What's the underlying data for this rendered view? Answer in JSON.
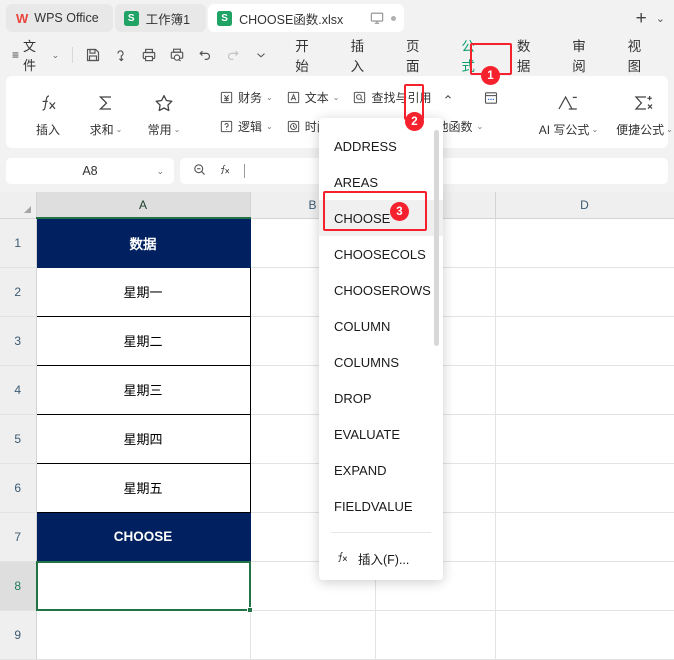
{
  "titlebar": {
    "app_label": "WPS Office",
    "app_mark": "W",
    "tabs": [
      {
        "icon": "spreadsheet-icon",
        "icon_letter": "S",
        "label": "工作簿1",
        "active": false
      },
      {
        "icon": "spreadsheet-icon",
        "icon_letter": "S",
        "label": "CHOOSE函数.xlsx",
        "active": true
      }
    ],
    "monitor_icon": "monitor-icon",
    "unsaved_dot": "unsaved-dot",
    "new_tab_label": "+",
    "tab_menu_caret": "⌄"
  },
  "menubar": {
    "hamburger": "≡",
    "file_label": "文件",
    "file_caret": "⌄",
    "quick_access": [
      {
        "name": "save-icon",
        "disabled": false
      },
      {
        "name": "cloud-save-icon",
        "disabled": false
      },
      {
        "name": "print-icon",
        "disabled": false
      },
      {
        "name": "print-preview-icon",
        "disabled": false
      },
      {
        "name": "undo-icon",
        "disabled": false
      },
      {
        "name": "redo-icon",
        "disabled": true
      },
      {
        "name": "qat-more-icon",
        "disabled": false
      }
    ],
    "tabs": [
      {
        "label": "开始",
        "active": false
      },
      {
        "label": "插入",
        "active": false
      },
      {
        "label": "页面",
        "active": false
      },
      {
        "label": "公式",
        "active": true
      },
      {
        "label": "数据",
        "active": false
      },
      {
        "label": "审阅",
        "active": false
      },
      {
        "label": "视图",
        "active": false
      }
    ]
  },
  "ribbon": {
    "big_buttons": [
      {
        "icon": "fx-icon",
        "label": "插入",
        "caret": ""
      },
      {
        "icon": "sigma-icon",
        "label": "求和",
        "caret": "⌄"
      },
      {
        "icon": "star-icon",
        "label": "常用",
        "caret": "⌄"
      }
    ],
    "func_groups": [
      {
        "icon": "finance-icon",
        "label": "财务",
        "caret": "⌄"
      },
      {
        "icon": "text-icon",
        "label": "文本",
        "caret": "⌄"
      },
      {
        "icon": "lookup-icon",
        "label": "查找与引用",
        "caret": "⌃"
      },
      {
        "icon": "logic-icon",
        "label": "逻辑",
        "caret": "⌄"
      },
      {
        "icon": "time-icon",
        "label": "时间",
        "caret": "⌄"
      },
      {
        "icon": "other-func-icon",
        "label": "他函数",
        "caret": "⌄"
      }
    ],
    "ai_buttons": [
      {
        "icon": "ai-formula-icon",
        "label": "AI 写公式",
        "caret": "⌄"
      },
      {
        "icon": "quick-formula-icon",
        "label": "便捷公式",
        "caret": "⌄"
      }
    ]
  },
  "formula_bar": {
    "namebox_value": "A8",
    "namebox_caret": "⌄",
    "search_icon": "search-function-icon",
    "fx_icon": "fx-icon",
    "formula_value": ""
  },
  "dropdown": {
    "items": [
      {
        "label": "ADDRESS",
        "highlighted": false
      },
      {
        "label": "AREAS",
        "highlighted": false
      },
      {
        "label": "CHOOSE",
        "highlighted": true
      },
      {
        "label": "CHOOSECOLS",
        "highlighted": false
      },
      {
        "label": "CHOOSEROWS",
        "highlighted": false
      },
      {
        "label": "COLUMN",
        "highlighted": false
      },
      {
        "label": "COLUMNS",
        "highlighted": false
      },
      {
        "label": "DROP",
        "highlighted": false
      },
      {
        "label": "EVALUATE",
        "highlighted": false
      },
      {
        "label": "EXPAND",
        "highlighted": false
      },
      {
        "label": "FIELDVALUE",
        "highlighted": false
      }
    ],
    "footer_icon": "fx-icon",
    "footer_label": "插入(F)..."
  },
  "sheet": {
    "columns": [
      "A",
      "B",
      "C",
      "D"
    ],
    "selected_column": "A",
    "rows": [
      "1",
      "2",
      "3",
      "4",
      "5",
      "6",
      "7",
      "8",
      "9"
    ],
    "selected_row": "8",
    "cells": {
      "A1": "数据",
      "A2": "星期一",
      "A3": "星期二",
      "A4": "星期三",
      "A5": "星期四",
      "A6": "星期五",
      "A7": "CHOOSE",
      "A8": ""
    },
    "active_cell": "A8"
  },
  "annotations": [
    {
      "badge": "1",
      "target": "formula-tab"
    },
    {
      "badge": "2",
      "target": "lookup-dropdown-caret"
    },
    {
      "badge": "3",
      "target": "choose-menu-item"
    }
  ],
  "colors": {
    "header_navy": "#002060",
    "accent_green": "#0e9f6e",
    "selection_green": "#217346",
    "annotation_red": "#f5222d"
  }
}
